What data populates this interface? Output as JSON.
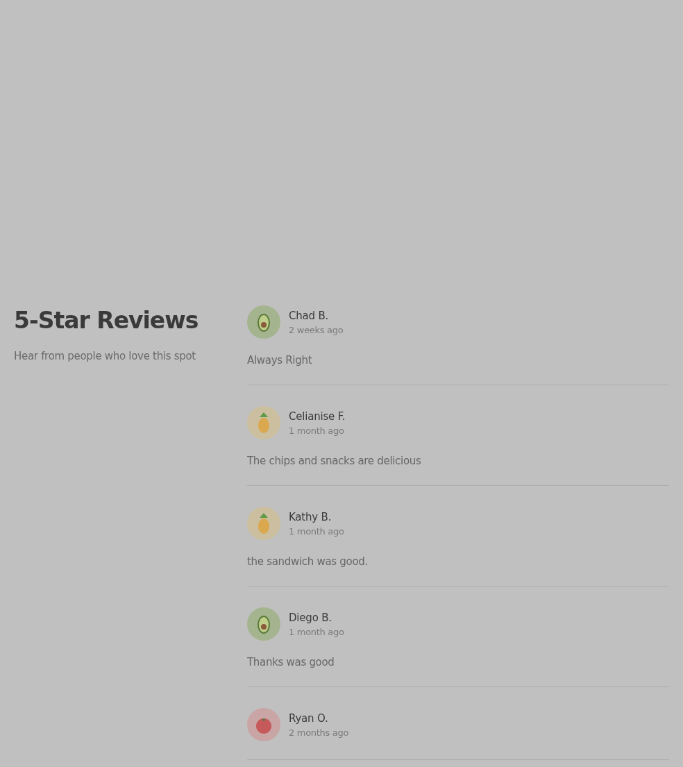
{
  "header": {
    "title": "5-Star Reviews",
    "subtitle": "Hear from people who love this spot"
  },
  "reviews": [
    {
      "name": "Chad B.",
      "date": "2 weeks ago",
      "text": "Always Right",
      "avatar": {
        "kind": "avocado"
      }
    },
    {
      "name": "Celianise F.",
      "date": "1 month ago",
      "text": "The chips and snacks are delicious",
      "avatar": {
        "kind": "pineapple"
      }
    },
    {
      "name": "Kathy B.",
      "date": "1 month ago",
      "text": "the sandwich was good.",
      "avatar": {
        "kind": "pineapple"
      }
    },
    {
      "name": "Diego B.",
      "date": "1 month ago",
      "text": "Thanks was good",
      "avatar": {
        "kind": "avocado"
      }
    },
    {
      "name": "Ryan O.",
      "date": "2 months ago",
      "avatar": {
        "kind": "tomato"
      }
    }
  ]
}
